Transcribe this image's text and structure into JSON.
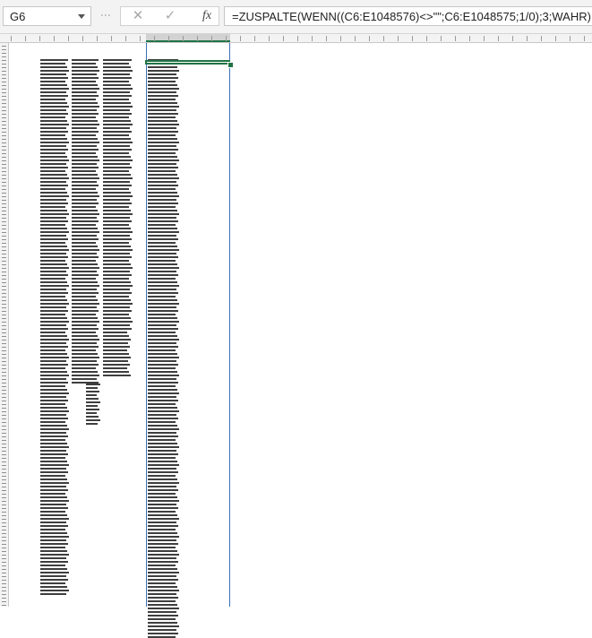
{
  "formula_bar": {
    "name_box": "G6",
    "cancel_icon": "close-icon",
    "enter_icon": "check-icon",
    "function_icon": "fx-icon",
    "function_label": "fx",
    "formula": "=ZUSPALTE(WENN((C6:E1048576)<>\"\";C6:E1048575;1/0);3;WAHR)"
  },
  "sheet": {
    "selected_cell": "G6",
    "selection_color": "#217346",
    "spill_border_color": "#3b6fb6",
    "source_columns": [
      "C",
      "D",
      "E"
    ],
    "result_column": "G"
  }
}
